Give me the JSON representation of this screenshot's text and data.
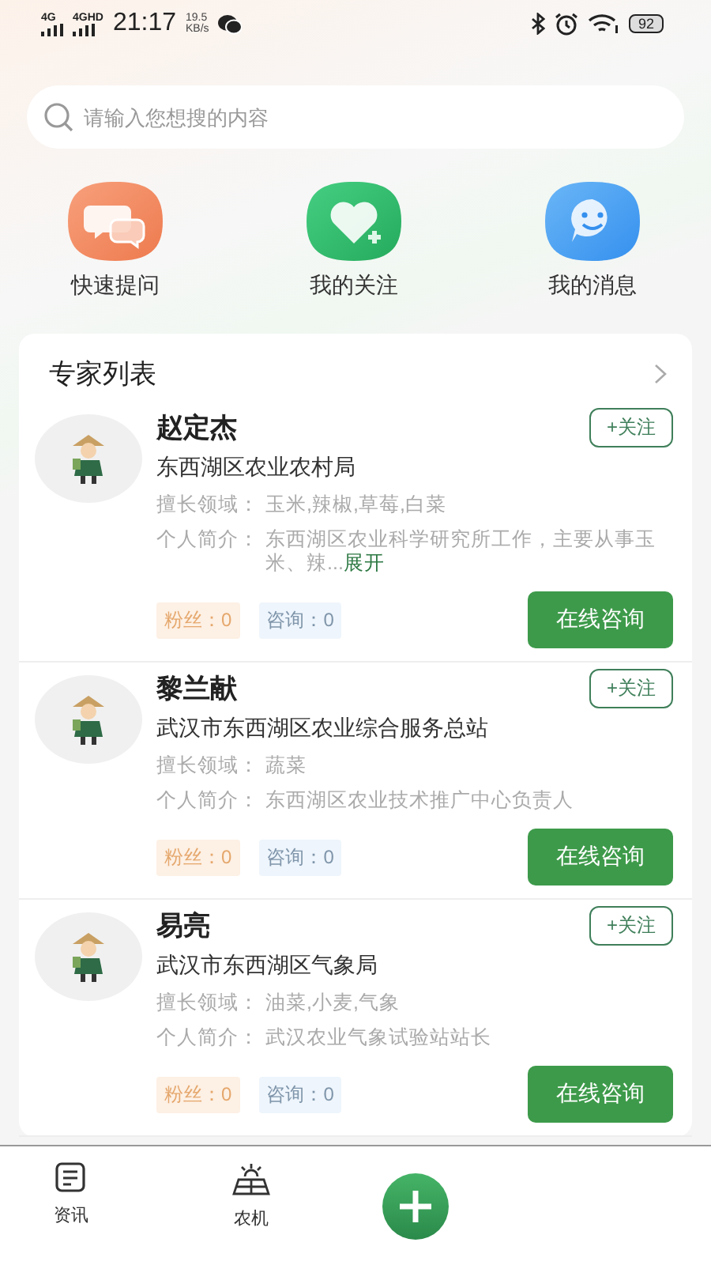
{
  "status_bar": {
    "network_1": "4G",
    "network_2": "4GHD",
    "time": "21:17",
    "speed": "19.5",
    "speed_unit": "KB/s",
    "battery": "92"
  },
  "search": {
    "placeholder": "请输入您想搜的内容"
  },
  "shortcuts": [
    {
      "label": "快速提问",
      "kind": "chat"
    },
    {
      "label": "我的关注",
      "kind": "heart"
    },
    {
      "label": "我的消息",
      "kind": "smile"
    }
  ],
  "expert_list": {
    "title": "专家列表",
    "experts": [
      {
        "name": "赵定杰",
        "org": "东西湖区农业农村局",
        "specialty_label": "擅长领域：",
        "specialty": "玉米,辣椒,草莓,白菜",
        "intro_label": "个人简介：",
        "intro": "东西湖区农业科学研究所工作，主要从事玉米、辣...",
        "expand": "展开",
        "follow": "+关注",
        "fans": "粉丝：0",
        "consults": "咨询：0",
        "consult_button": "在线咨询"
      },
      {
        "name": "黎兰献",
        "org": "武汉市东西湖区农业综合服务总站",
        "specialty_label": "擅长领域：",
        "specialty": "蔬菜",
        "intro_label": "个人简介：",
        "intro": "东西湖区农业技术推广中心负责人",
        "follow": "+关注",
        "fans": "粉丝：0",
        "consults": "咨询：0",
        "consult_button": "在线咨询"
      },
      {
        "name": "易亮",
        "org": "武汉市东西湖区气象局",
        "specialty_label": "擅长领域：",
        "specialty": "油菜,小麦,气象",
        "intro_label": "个人简介：",
        "intro": "武汉农业气象试验站站长",
        "follow": "+关注",
        "fans": "粉丝：0",
        "consults": "咨询：0",
        "consult_button": "在线咨询"
      }
    ]
  },
  "bottom_nav": [
    {
      "label": "资讯",
      "kind": "news"
    },
    {
      "label": "农机",
      "kind": "machine"
    }
  ],
  "fab": {
    "kind": "add"
  }
}
